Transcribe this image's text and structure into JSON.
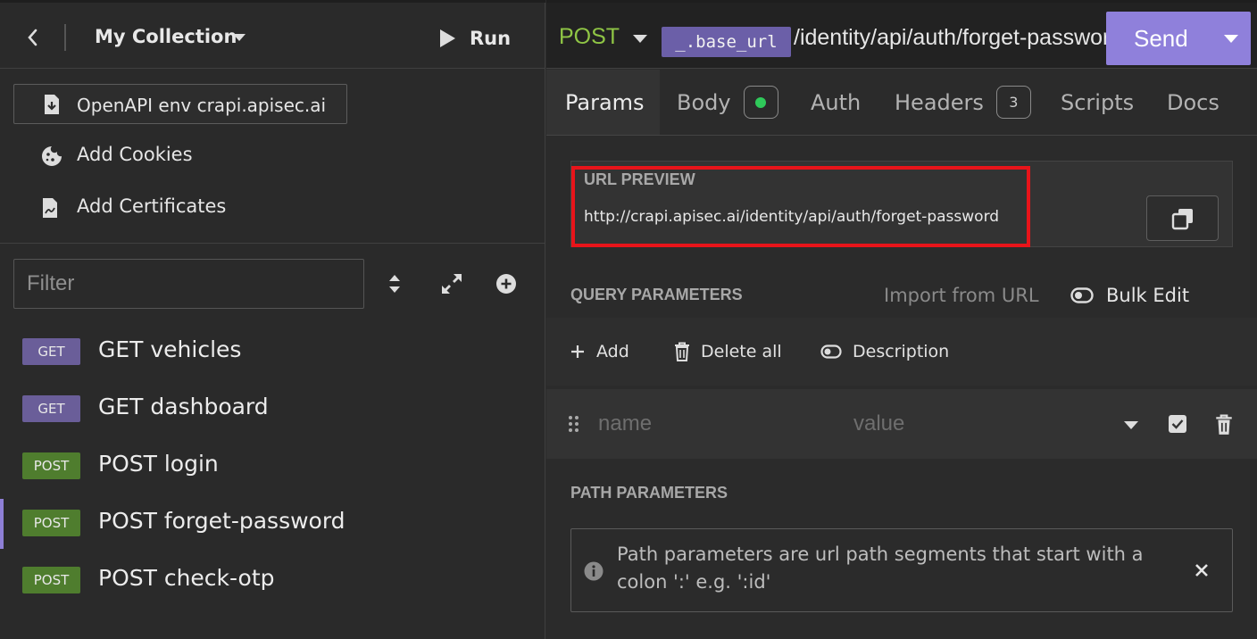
{
  "sidebar": {
    "collection_title": "My Collection",
    "run_label": "Run",
    "environment_label": "OpenAPI env crapi.apisec.ai",
    "actions": [
      {
        "label": "Add Cookies",
        "icon": "cookie-icon"
      },
      {
        "label": "Add Certificates",
        "icon": "certificate-icon"
      }
    ],
    "filter_placeholder": "Filter",
    "requests": [
      {
        "method": "GET",
        "name": "GET vehicles"
      },
      {
        "method": "GET",
        "name": "GET dashboard"
      },
      {
        "method": "POST",
        "name": "POST login"
      },
      {
        "method": "POST",
        "name": "POST forget-password",
        "active": true
      },
      {
        "method": "POST",
        "name": "POST check-otp"
      }
    ]
  },
  "request": {
    "method": "POST",
    "base_url_var": "_.base_url",
    "path": "/identity/api/auth/forget-password",
    "send_label": "Send"
  },
  "tabs": [
    {
      "label": "Params",
      "active": true
    },
    {
      "label": "Body",
      "indicator": "dot"
    },
    {
      "label": "Auth"
    },
    {
      "label": "Headers",
      "count": "3"
    },
    {
      "label": "Scripts"
    },
    {
      "label": "Docs"
    }
  ],
  "url_preview": {
    "title": "URL PREVIEW",
    "url": "http://crapi.apisec.ai/identity/api/auth/forget-password"
  },
  "query_params": {
    "title": "QUERY PARAMETERS",
    "import_label": "Import from URL",
    "bulk_edit_label": "Bulk Edit",
    "add_label": "Add",
    "delete_all_label": "Delete all",
    "description_label": "Description",
    "name_placeholder": "name",
    "value_placeholder": "value"
  },
  "path_params": {
    "title": "PATH PARAMETERS",
    "info": "Path parameters are url path segments that start with a colon ':' e.g. ':id'"
  },
  "colors": {
    "accent": "#8f80db",
    "get_badge": "#6a5e99",
    "post_badge": "#4f7d2e",
    "post_method": "#8fc545",
    "highlight": "#e8141a",
    "body_indicator": "#2fc95a"
  }
}
